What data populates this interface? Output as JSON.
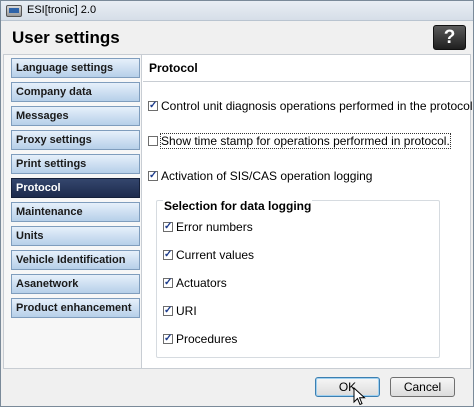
{
  "window": {
    "title": "ESI[tronic] 2.0"
  },
  "header": {
    "title": "User settings",
    "help_label": "?"
  },
  "sidebar": {
    "items": [
      {
        "label": "Language settings",
        "active": false
      },
      {
        "label": "Company data",
        "active": false
      },
      {
        "label": "Messages",
        "active": false
      },
      {
        "label": "Proxy settings",
        "active": false
      },
      {
        "label": "Print settings",
        "active": false
      },
      {
        "label": "Protocol",
        "active": true
      },
      {
        "label": "Maintenance",
        "active": false
      },
      {
        "label": "Units",
        "active": false
      },
      {
        "label": "Vehicle Identification",
        "active": false
      },
      {
        "label": "Asanetwork",
        "active": false
      },
      {
        "label": "Product enhancement",
        "active": false
      }
    ]
  },
  "panel": {
    "title": "Protocol",
    "options": [
      {
        "label": "Control unit diagnosis operations performed in the protocol",
        "checked": true
      },
      {
        "label": "Show time stamp for operations performed in protocol.",
        "checked": false
      },
      {
        "label": "Activation of SIS/CAS operation logging",
        "checked": true
      }
    ],
    "logging_group": {
      "title": "Selection for data logging",
      "items": [
        {
          "label": "Error numbers",
          "checked": true
        },
        {
          "label": "Current values",
          "checked": true
        },
        {
          "label": "Actuators",
          "checked": true
        },
        {
          "label": "URI",
          "checked": true
        },
        {
          "label": "Procedures",
          "checked": true
        }
      ]
    }
  },
  "footer": {
    "ok_label": "OK",
    "cancel_label": "Cancel"
  },
  "check_mark": "✓",
  "help_label": "?"
}
